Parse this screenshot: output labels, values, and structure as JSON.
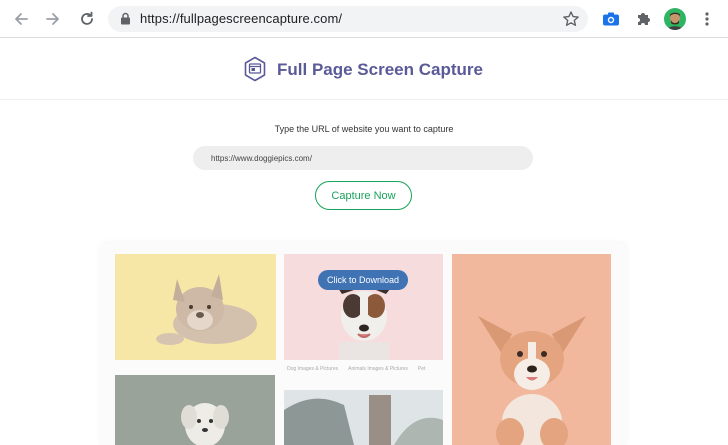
{
  "browser": {
    "url": "https://fullpagescreencapture.com/"
  },
  "site": {
    "title": "Full Page Screen Capture"
  },
  "form": {
    "prompt": "Type the URL of website you want to capture",
    "url_value": "https://www.doggiepics.com/",
    "capture_label": "Capture Now"
  },
  "preview": {
    "download_label": "Click to Download",
    "tags": [
      "Dog Images & Pictures",
      "Animals Images & Pictures",
      "Pet"
    ]
  },
  "colors": {
    "brand": "#5b5a99",
    "accent_green": "#1aa35a",
    "download_blue": "#3f73b4"
  },
  "icons": [
    "back-arrow-icon",
    "forward-arrow-icon",
    "reload-icon",
    "lock-icon",
    "star-icon",
    "camera-extension-icon",
    "puzzle-extension-icon",
    "kebab-menu-icon",
    "logo-icon"
  ]
}
